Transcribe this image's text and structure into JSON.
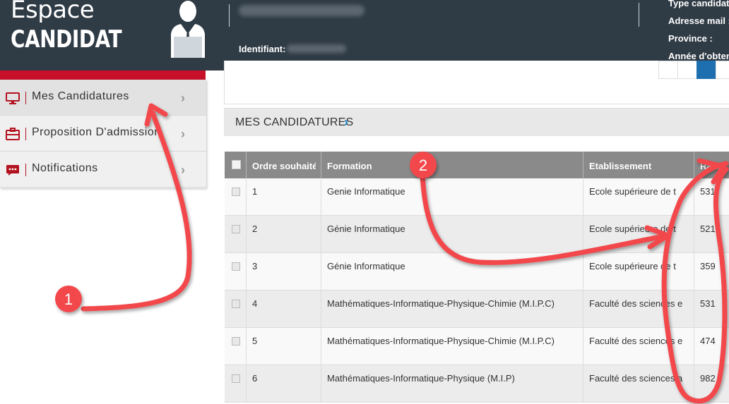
{
  "header": {
    "brand_top": "Espace",
    "brand_bottom": "CANDIDAT",
    "identifier_label": "Identifiant:",
    "info_lines": [
      "Type candidat :",
      "Adresse mail :",
      "Province :",
      "Année d'obtention :"
    ]
  },
  "sidebar": {
    "items": [
      {
        "label": "Mes Candidatures",
        "icon": "monitor-icon"
      },
      {
        "label": "Proposition D'admission",
        "icon": "briefcase-icon"
      },
      {
        "label": "Notifications",
        "icon": "chat-icon"
      }
    ]
  },
  "section": {
    "title": "MES CANDIDATURES"
  },
  "table": {
    "columns": [
      "Ordre souhaité",
      "Formation",
      "Etablissement",
      "Rang"
    ],
    "rows": [
      {
        "ordre": "1",
        "formation": "Genie Informatique",
        "etablissement": "Ecole supérieure de t",
        "rang": "531"
      },
      {
        "ordre": "2",
        "formation": "Génie Informatique",
        "etablissement": "Ecole supérieure de t",
        "rang": "521"
      },
      {
        "ordre": "3",
        "formation": "Génie Informatique",
        "etablissement": "Ecole supérieure de t",
        "rang": "359"
      },
      {
        "ordre": "4",
        "formation": "Mathématiques-Informatique-Physique-Chimie (M.I.P.C)",
        "etablissement": "Faculté des sciences e",
        "rang": "531"
      },
      {
        "ordre": "5",
        "formation": "Mathématiques-Informatique-Physique-Chimie (M.I.P.C)",
        "etablissement": "Faculté des sciences e",
        "rang": "474"
      },
      {
        "ordre": "6",
        "formation": "Mathématiques-Informatique-Physique (M.I.P)",
        "etablissement": "Faculté des sciences a",
        "rang": "982"
      }
    ]
  },
  "annotations": {
    "badge1": "1",
    "badge2": "2",
    "color": "#f2474c"
  }
}
